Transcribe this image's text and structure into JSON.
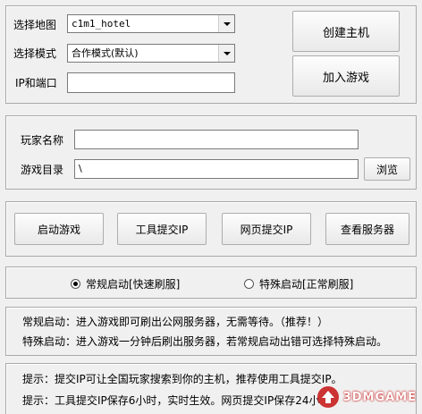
{
  "host": {
    "map_label": "选择地图",
    "map_value": "c1m1_hotel",
    "mode_label": "选择模式",
    "mode_value": "合作模式(默认)",
    "ip_label": "IP和端口",
    "ip_value": "",
    "create_button": "创建主机",
    "join_button": "加入游戏"
  },
  "player": {
    "name_label": "玩家名称",
    "name_value": "",
    "dir_label": "游戏目录",
    "dir_value": "\\",
    "browse_button": "浏览"
  },
  "actions": {
    "launch": "启动游戏",
    "tool_submit_ip": "工具提交IP",
    "web_submit_ip": "网页提交IP",
    "view_servers": "查看服务器"
  },
  "launch_mode": {
    "normal": "常规启动[快速刷服]",
    "special": "特殊启动[正常刷服]",
    "selected": "normal"
  },
  "launch_notes": [
    "常规启动：进入游戏即可刷出公网服务器，无需等待。（推荐！）",
    "特殊启动：进入游戏一分钟后刷出服务器，若常规启动出错可选择特殊启动。"
  ],
  "tips": [
    "提示：提交IP可让全国玩家搜索到你的主机，推荐使用工具提交IP。",
    "提示：工具提交IP保存6小时，实时生效。网页提交IP保存24小"
  ],
  "watermark": {
    "text": "3DMGAME"
  },
  "colors": {
    "window_bg": "#f0f0f0",
    "border": "#a9a9a9",
    "watermark_red": "#cc3333"
  }
}
